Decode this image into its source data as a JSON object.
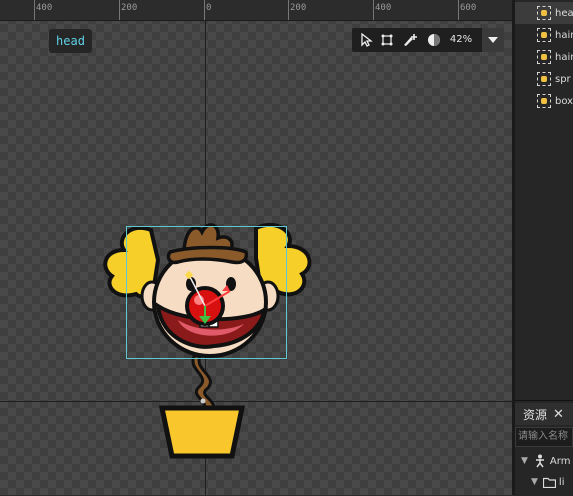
{
  "ruler": {
    "ticks": [
      "400",
      "200",
      "0",
      "200",
      "400",
      "600"
    ]
  },
  "stage": {
    "selected_name": "head"
  },
  "toolbar": {
    "zoom": "42%"
  },
  "scene_tree": {
    "items": [
      "head",
      "hair",
      "hair",
      "spr",
      "box"
    ]
  },
  "resources": {
    "title": "资源",
    "close": "✕",
    "search_placeholder": "请输入名称",
    "items": [
      "Arm",
      "li"
    ]
  },
  "colors": {
    "hair": "#f7cf29",
    "nose": "#e01010",
    "pot": "#f9c72c",
    "hat": "#8b5a2b",
    "selection": "#60c8d0"
  }
}
